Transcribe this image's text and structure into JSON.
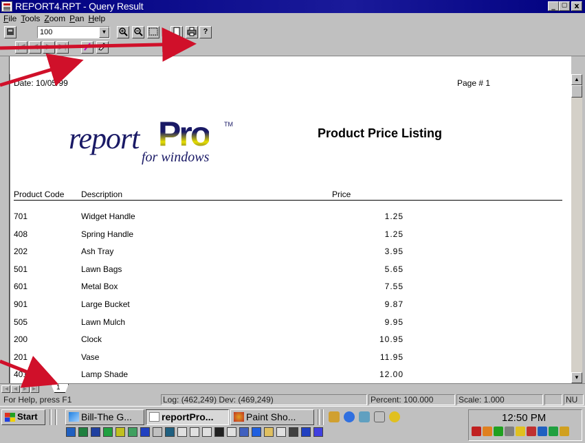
{
  "window": {
    "title": "REPORT4.RPT - Query Result",
    "controls": {
      "minimize": "_",
      "maximize": "□",
      "close": "x"
    }
  },
  "menu": [
    {
      "label": "File",
      "u": "F"
    },
    {
      "label": "Tools",
      "u": "T"
    },
    {
      "label": "Zoom",
      "u": "Z"
    },
    {
      "label": "Pan",
      "u": "P"
    },
    {
      "label": "Help",
      "u": "H"
    }
  ],
  "toolbar": {
    "zoom_value": "100",
    "icons": [
      "close-report-icon",
      "zoom-in-icon",
      "zoom-out-icon",
      "zoom-fit-icon",
      "page-icon",
      "print-icon",
      "help-icon"
    ]
  },
  "navbar": {
    "icons": [
      "first-page-icon",
      "previous-page-icon",
      "next-page-icon",
      "last-page-icon",
      "pencil-icon",
      "eraser-icon"
    ]
  },
  "report": {
    "date_label": "Date:",
    "date_value": "10/05/99",
    "page_label": "Page #",
    "page_value": "1",
    "logo": {
      "word1": "report",
      "word2": "Pro",
      "tm": "TM",
      "sub": "for windows"
    },
    "title": "Product Price Listing",
    "columns": [
      "Product Code",
      "Description",
      "Price"
    ],
    "rows": [
      {
        "code": "701",
        "desc": "Widget Handle",
        "price": "1.25"
      },
      {
        "code": "408",
        "desc": "Spring Handle",
        "price": "1.25"
      },
      {
        "code": "202",
        "desc": "Ash Tray",
        "price": "3.95"
      },
      {
        "code": "501",
        "desc": "Lawn Bags",
        "price": "5.65"
      },
      {
        "code": "601",
        "desc": "Metal Box",
        "price": "7.55"
      },
      {
        "code": "901",
        "desc": "Large Bucket",
        "price": "9.87"
      },
      {
        "code": "505",
        "desc": "Lawn Mulch",
        "price": "9.95"
      },
      {
        "code": "200",
        "desc": "Clock",
        "price": "10.95"
      },
      {
        "code": "201",
        "desc": "Vase",
        "price": "11.95"
      },
      {
        "code": "401",
        "desc": "Lamp Shade",
        "price": "12.00"
      }
    ]
  },
  "page_tab": "1",
  "status": {
    "help": "For Help, press F1",
    "coords": "Log: (462,249) Dev: (469,249)",
    "percent": "Percent: 100.000",
    "scale": "Scale: 1.000",
    "num": "NU"
  },
  "taskbar": {
    "start": "Start",
    "buttons": [
      {
        "label": "Bill-The G..."
      },
      {
        "label": "reportPro..."
      },
      {
        "label": "Paint Sho..."
      }
    ],
    "clock": "12:50 PM"
  },
  "colors": {
    "title_bar": "#00007f",
    "annotation_arrow": "#d0102a",
    "logo_navy": "#1a1a66",
    "logo_yellow": "#e8e000"
  }
}
